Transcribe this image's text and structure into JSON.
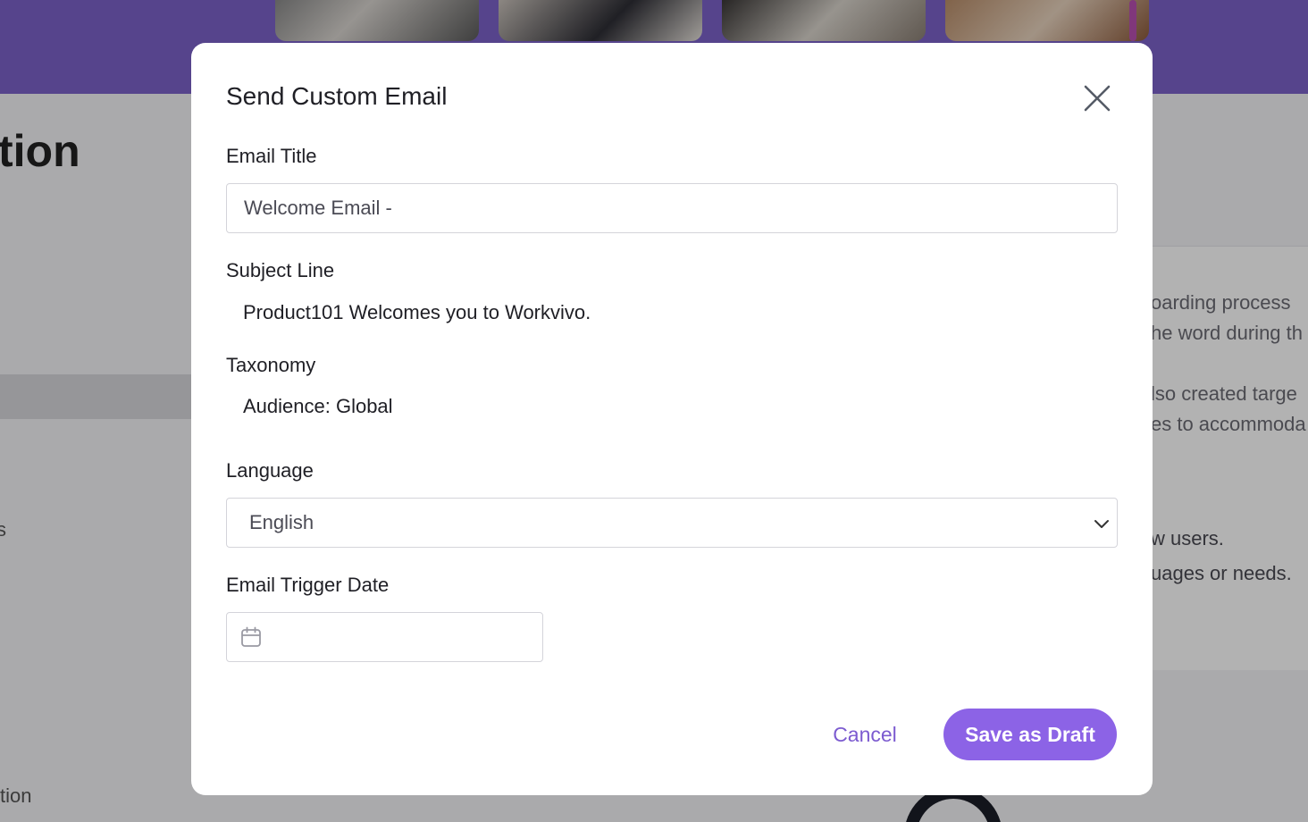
{
  "background": {
    "heading_fragment": "tion",
    "side_fragment_1": "s",
    "side_fragment_2": "tion",
    "right_text": [
      "oarding process",
      "he word during th",
      "lso created targe",
      "es to accommoda",
      "w users.",
      "uages or needs."
    ]
  },
  "modal": {
    "title": "Send Custom Email",
    "close_icon": "close-icon",
    "email_title": {
      "label": "Email Title",
      "value": "Welcome Email -"
    },
    "subject_line": {
      "label": "Subject Line",
      "value": "Product101 Welcomes you to Workvivo."
    },
    "taxonomy": {
      "label": "Taxonomy",
      "value": "Audience: Global"
    },
    "language": {
      "label": "Language",
      "selected": "English",
      "icon": "chevron-down-icon"
    },
    "trigger_date": {
      "label": "Email Trigger Date",
      "value": "",
      "icon": "calendar-icon"
    },
    "actions": {
      "cancel_label": "Cancel",
      "save_label": "Save as Draft"
    }
  },
  "colors": {
    "banner": "#7b62c9",
    "accent": "#8c63e6",
    "link": "#7c5bd0"
  }
}
